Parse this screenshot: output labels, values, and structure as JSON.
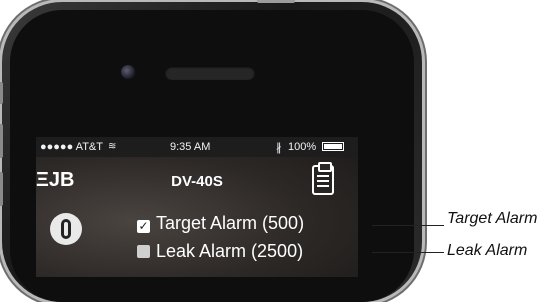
{
  "status_bar": {
    "carrier": "●●●●● AT&T",
    "wifi_icon": "wifi-icon",
    "time": "9:35 AM",
    "bluetooth": "∦",
    "battery_percent": "100%"
  },
  "nav": {
    "logo": "ΞJB",
    "title": "DV-40S",
    "report_icon": "clipboard-icon"
  },
  "alarms": [
    {
      "label": "Target Alarm (500)",
      "checked": true,
      "check_glyph": "✓"
    },
    {
      "label": "Leak Alarm (2500)",
      "checked": false,
      "check_glyph": ""
    }
  ],
  "callouts": [
    {
      "label": "Target Alarm"
    },
    {
      "label": "Leak Alarm"
    }
  ]
}
